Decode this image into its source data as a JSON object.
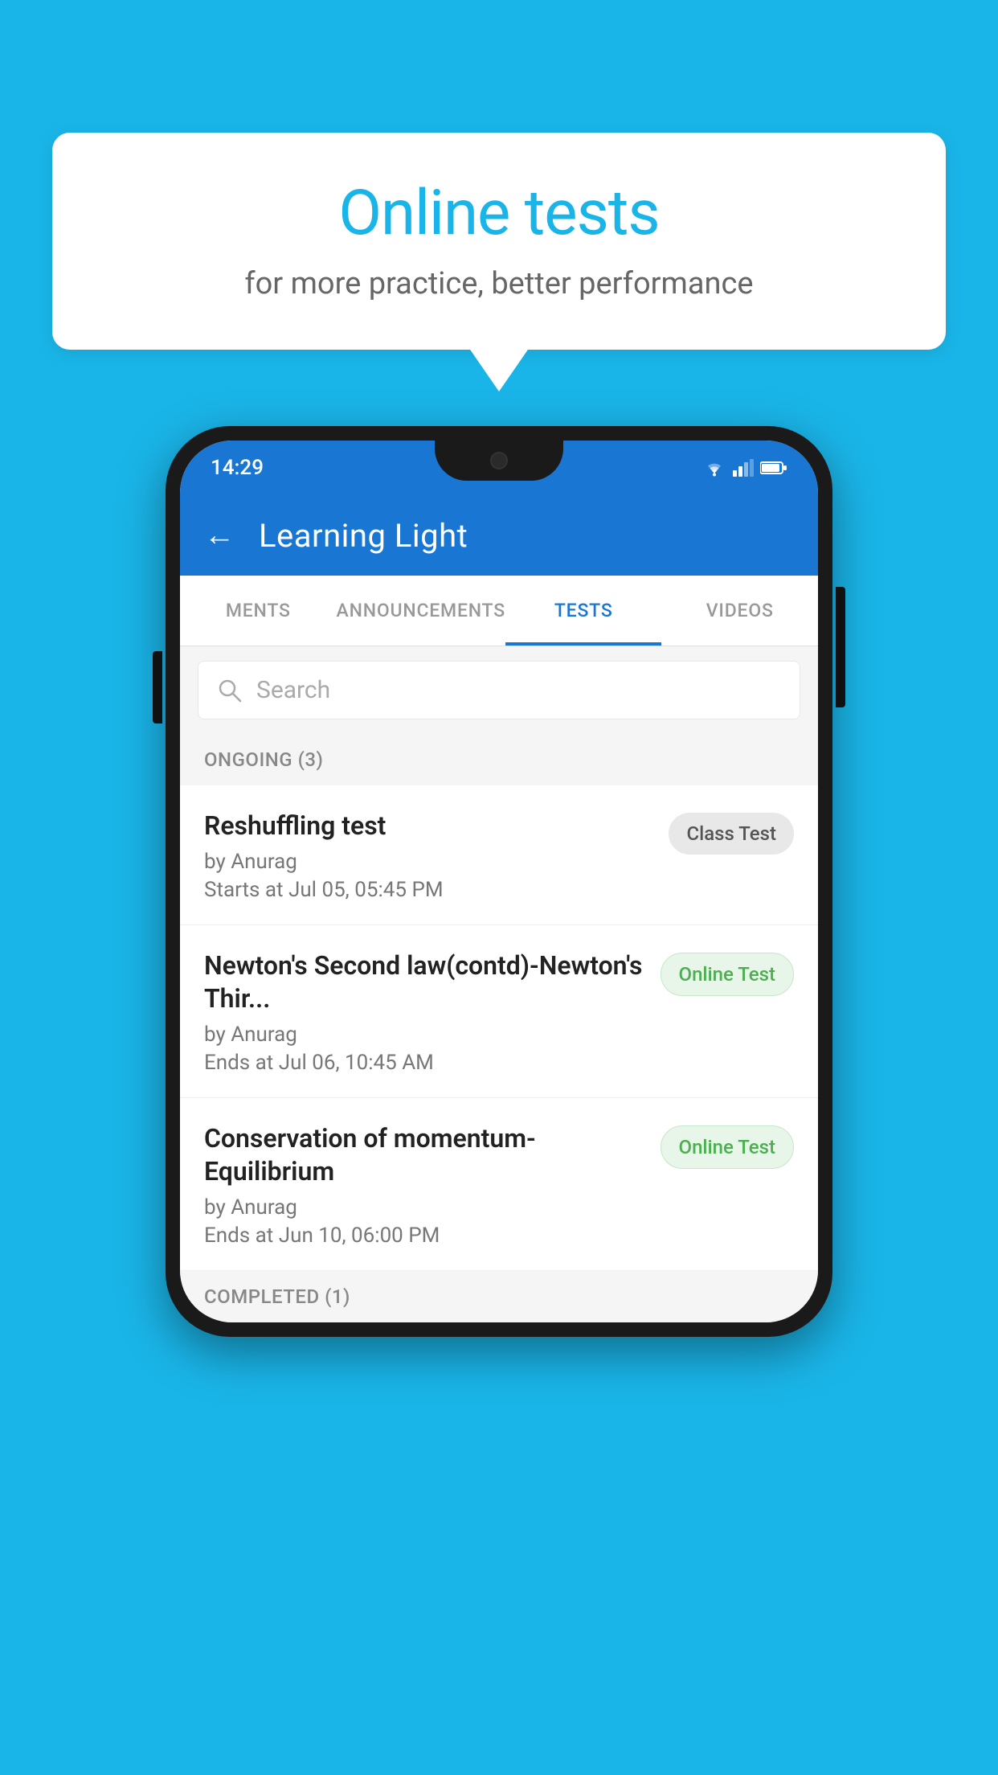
{
  "background": {
    "color": "#1ab5e8"
  },
  "speech_bubble": {
    "title": "Online tests",
    "subtitle": "for more practice, better performance"
  },
  "phone": {
    "status_bar": {
      "time": "14:29",
      "icons": [
        "wifi",
        "signal",
        "battery"
      ]
    },
    "header": {
      "title": "Learning Light",
      "back_label": "←"
    },
    "tabs": [
      {
        "label": "MENTS",
        "active": false
      },
      {
        "label": "ANNOUNCEMENTS",
        "active": false
      },
      {
        "label": "TESTS",
        "active": true
      },
      {
        "label": "VIDEOS",
        "active": false
      }
    ],
    "search": {
      "placeholder": "Search"
    },
    "ongoing_section": {
      "title": "ONGOING (3)"
    },
    "tests": [
      {
        "name": "Reshuffling test",
        "author": "by Anurag",
        "date": "Starts at  Jul 05, 05:45 PM",
        "badge": "Class Test",
        "badge_type": "class"
      },
      {
        "name": "Newton's Second law(contd)-Newton's Thir...",
        "author": "by Anurag",
        "date": "Ends at  Jul 06, 10:45 AM",
        "badge": "Online Test",
        "badge_type": "online"
      },
      {
        "name": "Conservation of momentum-Equilibrium",
        "author": "by Anurag",
        "date": "Ends at  Jun 10, 06:00 PM",
        "badge": "Online Test",
        "badge_type": "online"
      }
    ],
    "completed_section": {
      "title": "COMPLETED (1)"
    }
  }
}
